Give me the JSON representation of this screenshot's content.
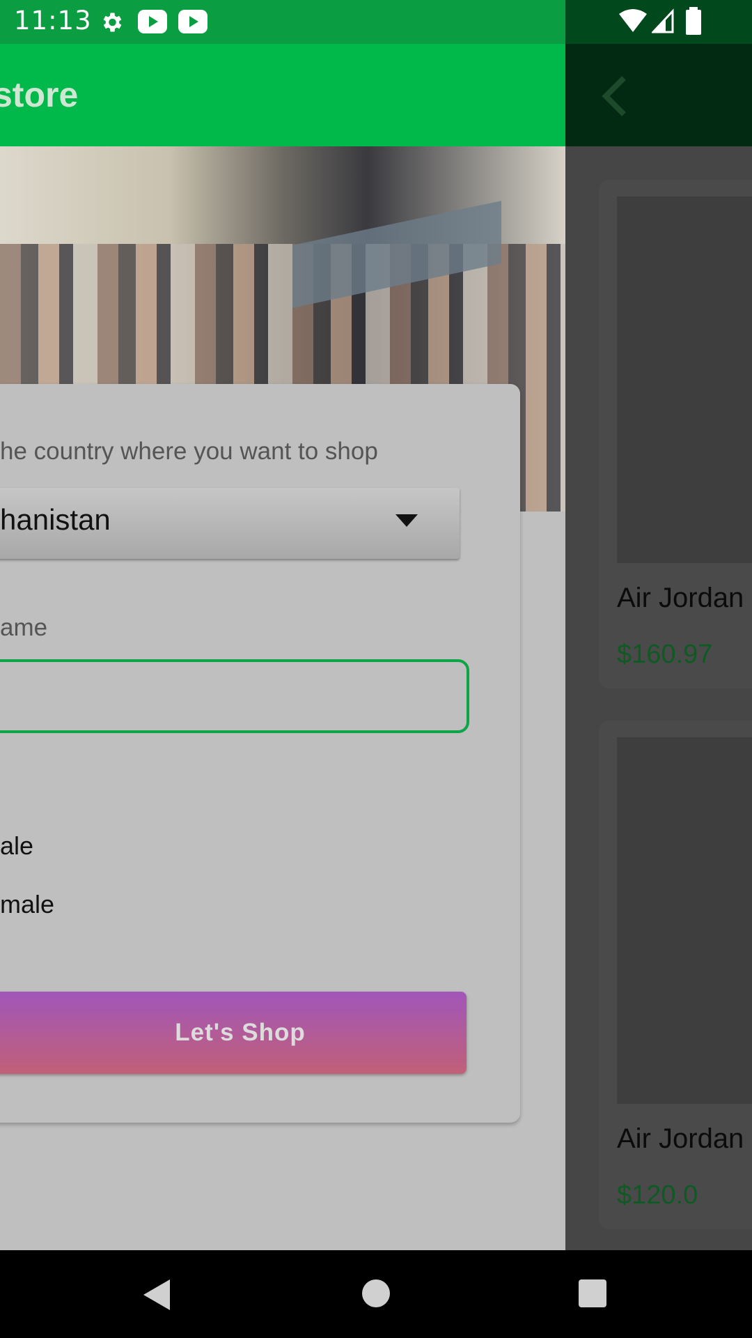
{
  "status_bar": {
    "time": "11:13",
    "icons": [
      "gear-icon",
      "youtube-icon",
      "youtube-icon",
      "wifi-icon",
      "signal-icon",
      "battery-icon"
    ]
  },
  "drawer": {
    "title": "store",
    "form": {
      "country_prompt": "he country where you want to shop",
      "country_value": "hanistan",
      "name_label": "ame",
      "name_value": "",
      "gender_options": [
        "ale",
        "male"
      ],
      "submit_label": "Let's  Shop"
    }
  },
  "products": [
    {
      "name": "Air Jordan",
      "price": "$160.97"
    },
    {
      "name": "Air Jordan",
      "price": "$120.0"
    }
  ],
  "colors": {
    "primary": "#00b94a",
    "status": "#0a9d42",
    "price": "#0f5a23",
    "button_top": "#a156b9",
    "button_bottom": "#c16078"
  }
}
